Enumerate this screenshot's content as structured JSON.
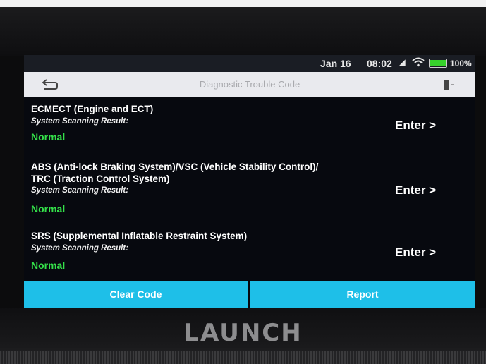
{
  "device": {
    "brand": "LAUNCH"
  },
  "status_bar": {
    "date": "Jan 16",
    "time": "08:02",
    "battery_percent": "100%"
  },
  "header": {
    "title": "Diagnostic Trouble Code"
  },
  "systems": [
    {
      "name_lines": [
        "ECMECT (Engine and ECT)"
      ],
      "result_label": "System Scanning Result:",
      "status": "Normal",
      "action": "Enter >"
    },
    {
      "name_lines": [
        "ABS (Anti-lock Braking System)/VSC (Vehicle Stability Control)/",
        "TRC (Traction Control System)"
      ],
      "result_label": "System Scanning Result:",
      "status": "Normal",
      "action": "Enter >"
    },
    {
      "name_lines": [
        "SRS (Supplemental Inflatable Restraint System)"
      ],
      "result_label": "System Scanning Result:",
      "status": "Normal",
      "action": "Enter >"
    }
  ],
  "footer": {
    "clear_code_label": "Clear Code",
    "report_label": "Report"
  },
  "colors": {
    "accent": "#1ebfe8",
    "status_normal": "#34e04a",
    "battery": "#37d22c"
  }
}
